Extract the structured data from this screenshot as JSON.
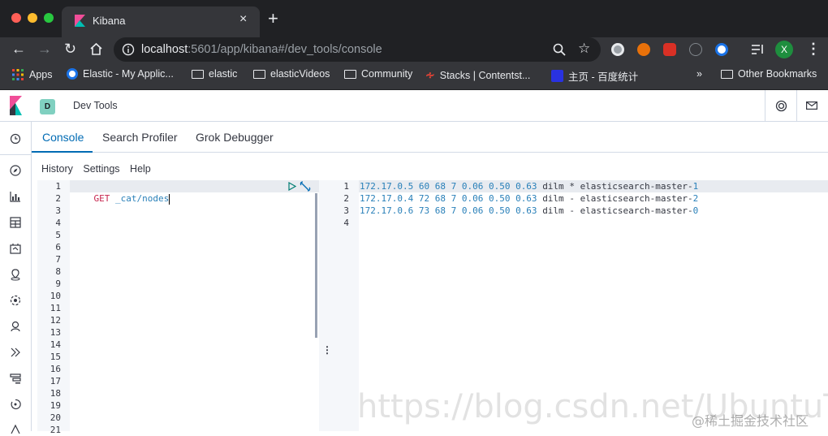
{
  "browser": {
    "tab_title": "Kibana",
    "tab_close": "×",
    "new_tab": "+",
    "url_host": "localhost",
    "url_rest": ":5601/app/kibana#/dev_tools/console",
    "profile_initial": "X",
    "bookmarks": [
      {
        "label": "Apps"
      },
      {
        "label": "Elastic - My Applic..."
      },
      {
        "label": "elastic"
      },
      {
        "label": "elasticVideos"
      },
      {
        "label": "Community"
      },
      {
        "label": "Stacks | Contentst..."
      },
      {
        "label": "主页 - 百度统计"
      },
      {
        "label": "»"
      },
      {
        "label": "Other Bookmarks"
      }
    ]
  },
  "app": {
    "space_initial": "D",
    "breadcrumb": "Dev Tools",
    "tabs": [
      {
        "label": "Console"
      },
      {
        "label": "Search Profiler"
      },
      {
        "label": "Grok Debugger"
      }
    ],
    "console_menu": [
      "History",
      "Settings",
      "Help"
    ]
  },
  "editor": {
    "line_numbers": "1\n2\n3\n4\n5\n6\n7\n8\n9\n10\n11\n12\n13\n14\n15\n16\n17\n18\n19\n20\n21",
    "method": "GET",
    "path": " _cat/nodes"
  },
  "output": {
    "line_numbers": "1\n2\n3\n4",
    "lines": [
      {
        "ip": "172.17.0.5",
        "nums": "60 68 7 0.06 0.50 0.63",
        "role": "dilm",
        "master": "*",
        "name": "elasticsearch-master-",
        "idx": "1"
      },
      {
        "ip": "172.17.0.4",
        "nums": "72 68 7 0.06 0.50 0.63",
        "role": "dilm",
        "master": "-",
        "name": "elasticsearch-master-",
        "idx": "2"
      },
      {
        "ip": "172.17.0.6",
        "nums": "73 68 7 0.06 0.50 0.63",
        "role": "dilm",
        "master": "-",
        "name": "elasticsearch-master-",
        "idx": "0"
      }
    ]
  },
  "watermark": {
    "url_text": "https://blog.csdn.net/UbuntuTouch",
    "site_text": "@稀土掘金技术社区"
  },
  "colors": {
    "accent": "#006bb4",
    "code_blue": "#2980b9",
    "code_green": "#00a69b"
  }
}
